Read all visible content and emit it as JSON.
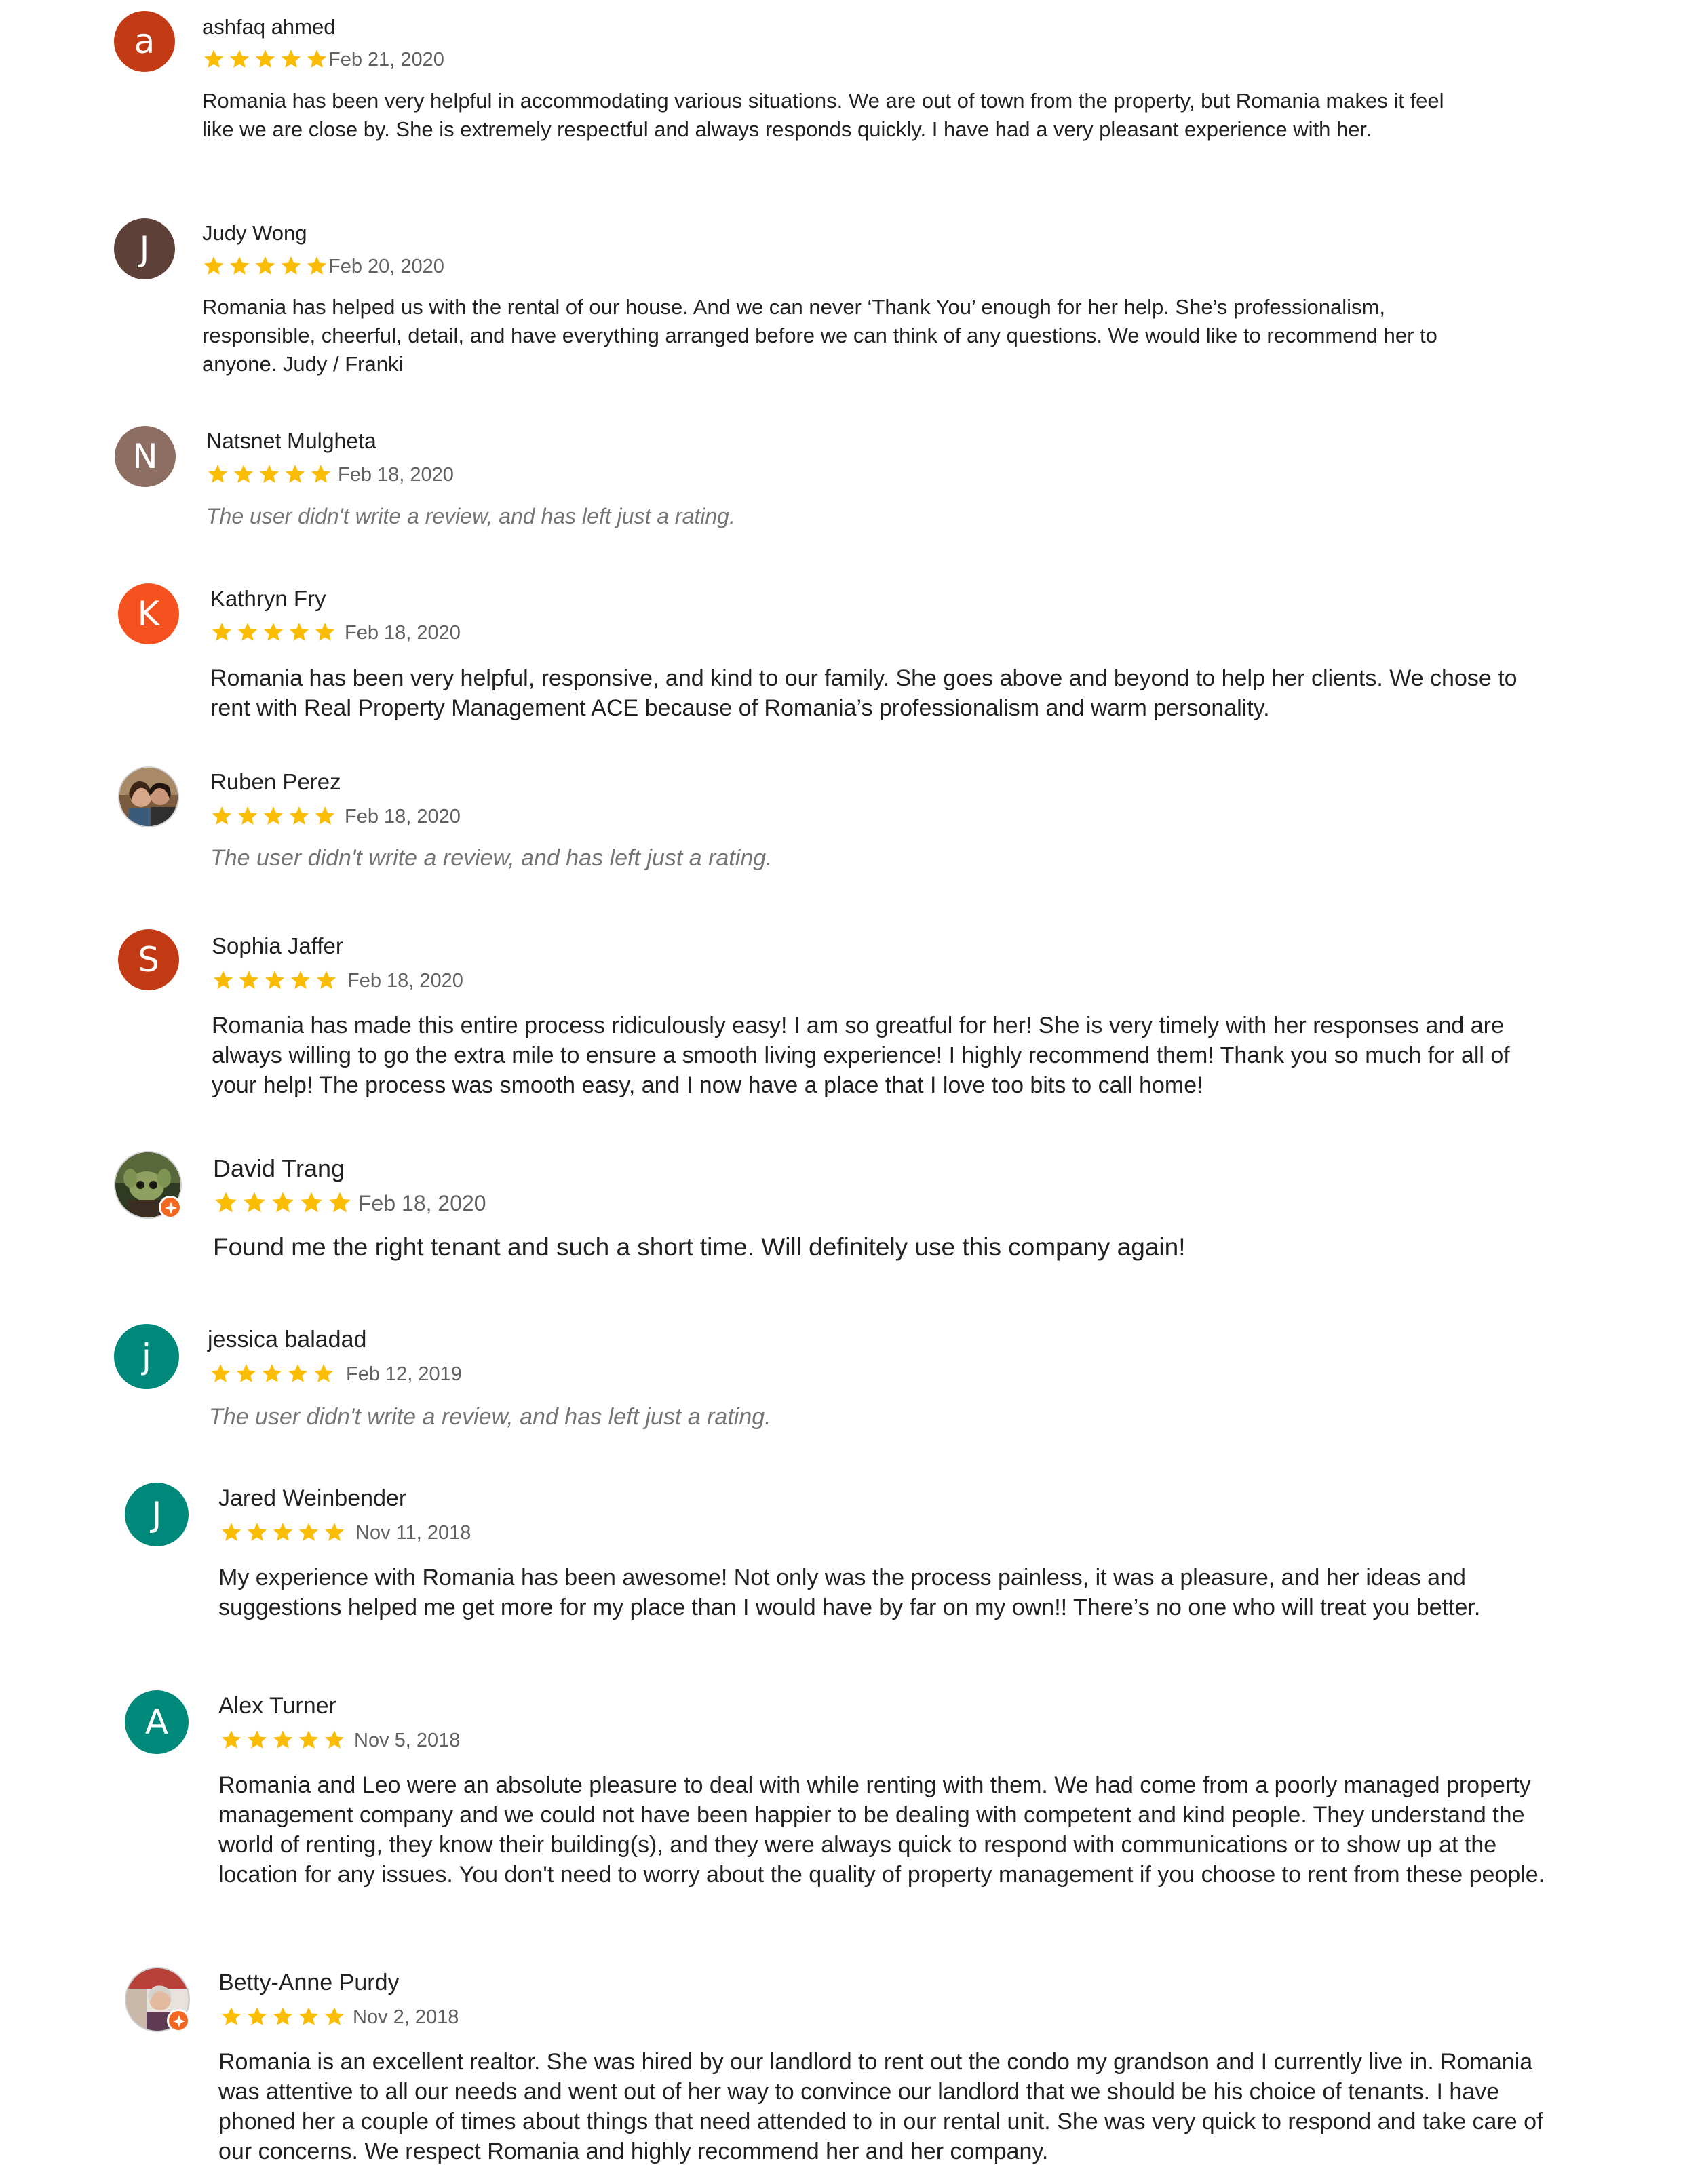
{
  "reviews": [
    {
      "name": "ashfaq ahmed",
      "initial": "a",
      "avatar_color": "#c23a14",
      "rating": 5,
      "date": "Feb 21, 2020",
      "text": "Romania has been very helpful in accommodating various situations. We are out of town from the property, but Romania makes it feel like we are close by. She is extremely respectful and always responds quickly. I have had a very pleasant experience with her."
    },
    {
      "name": "Judy Wong",
      "initial": "J",
      "avatar_color": "#5d4037",
      "rating": 5,
      "date": "Feb 20, 2020",
      "text": "Romania has helped us with the rental of our house. And we can never ‘Thank You’ enough for her help. She’s professionalism, responsible, cheerful, detail, and have everything arranged before we can think of any questions. We would like to recommend her to anyone. Judy / Franki"
    },
    {
      "name": "Natsnet Mulgheta",
      "initial": "N",
      "avatar_color": "#8d6e63",
      "rating": 5,
      "date": "Feb 18, 2020",
      "text": "The user didn't write a review, and has left just a rating."
    },
    {
      "name": "Kathryn Fry",
      "initial": "K",
      "avatar_color": "#f4511e",
      "rating": 5,
      "date": "Feb 18, 2020",
      "text": "Romania has been very helpful, responsive, and kind to our family. She goes above and beyond to help her clients. We chose to rent with Real Property Management ACE because of Romania’s professionalism and warm personality."
    },
    {
      "name": "Ruben Perez",
      "initial": "",
      "avatar_color": "#6d4c41",
      "rating": 5,
      "date": "Feb 18, 2020",
      "text": "The user didn't write a review, and has left just a rating."
    },
    {
      "name": "Sophia Jaffer",
      "initial": "S",
      "avatar_color": "#c23a14",
      "rating": 5,
      "date": "Feb 18, 2020",
      "text": "Romania has made this entire process ridiculously easy! I am so greatful for her! She is very timely with her responses and are always willing to go the extra mile to ensure a smooth living experience! I highly recommend them! Thank you so much for all of your help! The process was smooth easy, and I now have a place that I love too bits to call home!"
    },
    {
      "name": "David Trang",
      "initial": "",
      "avatar_color": "#6b7d4a",
      "rating": 5,
      "date": "Feb 18, 2020",
      "text": "Found me the right tenant and such a short time. Will definitely use this company again!"
    },
    {
      "name": "jessica baladad",
      "initial": "j",
      "avatar_color": "#00897b",
      "rating": 5,
      "date": "Feb 12, 2019",
      "text": "The user didn't write a review, and has left just a rating."
    },
    {
      "name": "Jared Weinbender",
      "initial": "J",
      "avatar_color": "#00897b",
      "rating": 5,
      "date": "Nov 11, 2018",
      "text": "My experience with Romania has been awesome! Not only was the process painless, it was a pleasure, and her ideas and suggestions helped me get more for my place than I would have by far on my own!! There’s no one who will treat you better."
    },
    {
      "name": "Alex Turner",
      "initial": "A",
      "avatar_color": "#00897b",
      "rating": 5,
      "date": "Nov 5, 2018",
      "text": "Romania and Leo were an absolute pleasure to deal with while renting with them. We had come from a poorly managed property management company and we could not have been happier to be dealing with competent and kind people. They understand the world of renting, they know their building(s), and they were always quick to respond with communications or to show up at the location for any issues. You don't need to worry about the quality of property management if you choose to rent from these people."
    },
    {
      "name": "Betty-Anne Purdy",
      "initial": "",
      "avatar_color": "#8c5a4a",
      "rating": 5,
      "date": "Nov 2, 2018",
      "text": "Romania is an excellent realtor. She was hired by our landlord to rent out the condo my grandson and I currently live in. Romania was attentive to all our needs and went out of her way to convince our landlord that we should be his choice of tenants. I have phoned her a couple of times about things that need attended to in our rental unit. She was very quick to respond and take care of our concerns. We respect Romania and highly recommend her and her company."
    }
  ],
  "star_color": "#fbbc04"
}
